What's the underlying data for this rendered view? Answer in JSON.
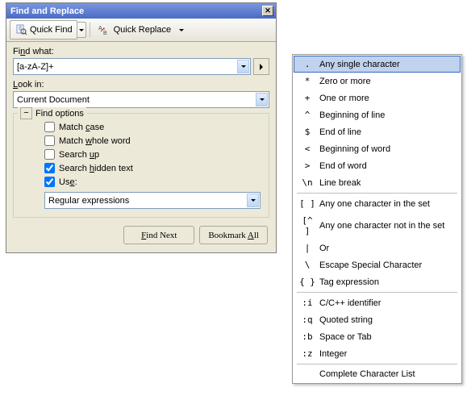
{
  "title": "Find and Replace",
  "toolbar": {
    "quickFind": "Quick Find",
    "quickReplace": "Quick Replace"
  },
  "labels": {
    "findWhat": "Find what:",
    "lookIn": "Look in:",
    "findOptions": "Find options",
    "findNext": "Find Next",
    "bookmarkAll": "Bookmark All"
  },
  "findValue": "[a-zA-Z]+",
  "lookInValue": "Current Document",
  "options": {
    "matchCase": {
      "label_pre": "Match ",
      "key": "c",
      "label_post": "ase",
      "checked": false
    },
    "matchWhole": {
      "label_pre": "Match ",
      "key": "w",
      "label_post": "hole word",
      "checked": false
    },
    "searchUp": {
      "label_pre": "Search ",
      "key": "u",
      "label_post": "p",
      "checked": false
    },
    "searchHidden": {
      "label_pre": "Search ",
      "key": "h",
      "label_post": "idden text",
      "checked": true
    },
    "use": {
      "label_pre": "Us",
      "key": "e",
      "label_post": ":",
      "checked": true
    }
  },
  "useValue": "Regular expressions",
  "menu": [
    {
      "sym": ".",
      "label": "Any single character",
      "hl": true
    },
    {
      "sym": "*",
      "label": "Zero or more"
    },
    {
      "sym": "+",
      "label": "One or more"
    },
    {
      "sym": "^",
      "label": "Beginning of line"
    },
    {
      "sym": "$",
      "label": "End of line"
    },
    {
      "sym": "<",
      "label": "Beginning of word"
    },
    {
      "sym": ">",
      "label": "End of word"
    },
    {
      "sym": "\\n",
      "label": "Line break"
    },
    {
      "sep": true
    },
    {
      "sym": "[ ]",
      "label": "Any one character in the set"
    },
    {
      "sym": "[^ ]",
      "label": "Any one character not in the set"
    },
    {
      "sym": "|",
      "label": "Or"
    },
    {
      "sym": "\\",
      "label": "Escape Special Character"
    },
    {
      "sym": "{ }",
      "label": "Tag expression"
    },
    {
      "sep": true
    },
    {
      "sym": ":i",
      "label": "C/C++ identifier"
    },
    {
      "sym": ":q",
      "label": "Quoted string"
    },
    {
      "sym": ":b",
      "label": "Space or Tab"
    },
    {
      "sym": ":z",
      "label": "Integer"
    },
    {
      "sep": true
    },
    {
      "sym": "",
      "label": "Complete Character List"
    }
  ]
}
